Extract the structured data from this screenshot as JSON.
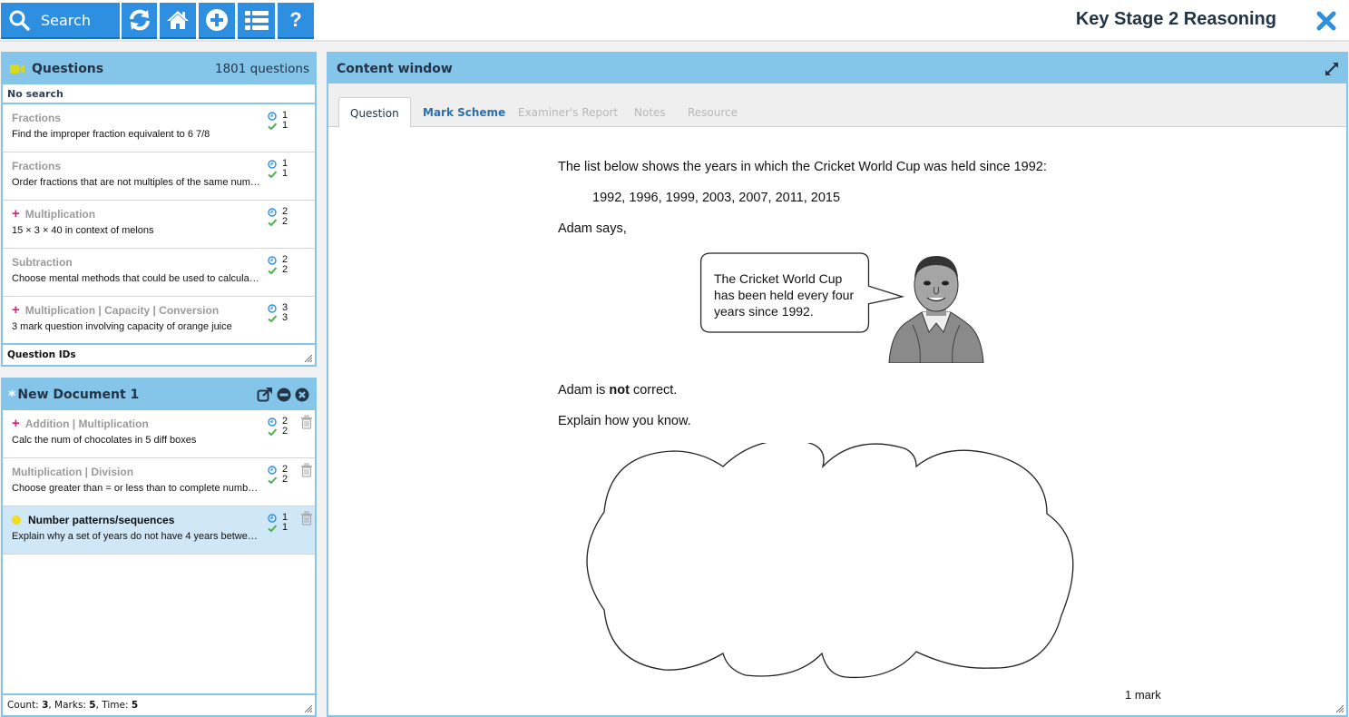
{
  "toolbar": {
    "search_label": "Search",
    "buttons": [
      {
        "name": "refresh",
        "icon": "refresh-icon"
      },
      {
        "name": "home",
        "icon": "home-icon"
      },
      {
        "name": "add",
        "icon": "plus-circle-icon"
      },
      {
        "name": "list",
        "icon": "list-icon"
      },
      {
        "name": "help",
        "icon": "question-icon",
        "label": "?"
      }
    ],
    "accent_color": "#2e8ee0"
  },
  "app_title": "Key Stage 2 Reasoning",
  "questions_panel": {
    "title": "Questions",
    "count_label": "1801 questions",
    "search_status": "No search",
    "footer_label": "Question IDs",
    "items": [
      {
        "topic": "Fractions",
        "desc": "Find the improper fraction equivalent to 6 7/8",
        "time": "1",
        "marks": "1",
        "marker": "none"
      },
      {
        "topic": "Fractions",
        "desc": "Order fractions that are not multiples of the same num…",
        "time": "1",
        "marks": "1",
        "marker": "none"
      },
      {
        "topic": "Multiplication",
        "desc": "15 × 3 × 40 in context of melons",
        "time": "2",
        "marks": "2",
        "marker": "plus"
      },
      {
        "topic": "Subtraction",
        "desc": "Choose mental methods that could be used to calcula…",
        "time": "2",
        "marks": "2",
        "marker": "none"
      },
      {
        "topic": "Multiplication | Capacity | Conversion",
        "desc": "3 mark question involving capacity of orange juice",
        "time": "3",
        "marks": "3",
        "marker": "plus"
      }
    ]
  },
  "document_panel": {
    "title": "New Document 1",
    "items": [
      {
        "topic": "Addition | Multiplication",
        "desc": "Calc the num of chocolates in 5 diff boxes",
        "time": "2",
        "marks": "2",
        "marker": "plus",
        "selected": false
      },
      {
        "topic": "Multiplication | Division",
        "desc": "Choose greater than = or less than to complete numbe…",
        "time": "2",
        "marks": "2",
        "marker": "none",
        "selected": false
      },
      {
        "topic": "Number patterns/sequences",
        "desc": "Explain why a set of years do not have 4 years betwee…",
        "time": "1",
        "marks": "1",
        "marker": "dot",
        "selected": true
      }
    ],
    "footer": {
      "count_label": "Count: ",
      "count": "3",
      "marks_label": ", Marks: ",
      "marks": "5",
      "time_label": ", Time: ",
      "time": "5"
    }
  },
  "content_window": {
    "title": "Content window",
    "tabs": [
      {
        "label": "Question",
        "state": "active"
      },
      {
        "label": "Mark Scheme",
        "state": "link"
      },
      {
        "label": "Examiner's Report",
        "state": "disabled"
      },
      {
        "label": "Notes",
        "state": "disabled"
      },
      {
        "label": "Resource",
        "state": "disabled"
      }
    ],
    "question": {
      "intro": "The list below shows the years in which the Cricket World Cup was held since 1992:",
      "years": "1992, 1996, 1999, 2003, 2007, 2011, 2015",
      "adam_says": "Adam says,",
      "bubble_lines": [
        "The Cricket World Cup",
        "has been held every four",
        "years since 1992."
      ],
      "statement_pre": "Adam is ",
      "statement_bold": "not",
      "statement_post": " correct.",
      "prompt": "Explain how you know.",
      "marks": "1 mark"
    }
  },
  "colors": {
    "panel_header": "#85c5ea",
    "selected_row": "#cfe7f6",
    "plus_marker": "#e0197d",
    "dot_marker": "#f2dd1f",
    "clock": "#2e8ee0",
    "check": "#4cb04c",
    "link_tab": "#2a6fb0"
  }
}
